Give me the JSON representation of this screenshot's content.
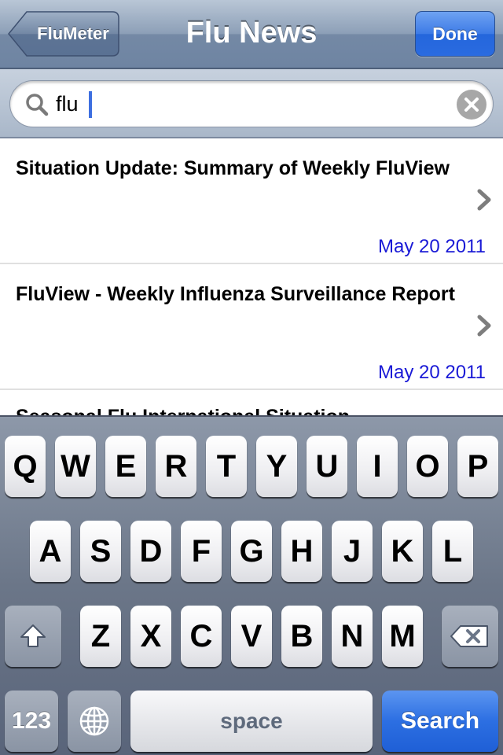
{
  "navbar": {
    "back_label": "FluMeter",
    "title": "Flu News",
    "done_label": "Done"
  },
  "search": {
    "value": "flu"
  },
  "list": {
    "items": [
      {
        "title": "Situation Update: Summary of Weekly FluView",
        "date": "May 20 2011"
      },
      {
        "title": "FluView - Weekly Influenza Surveillance Report",
        "date": "May 20 2011"
      },
      {
        "title": "Seasonal Flu International Situation"
      }
    ]
  },
  "keyboard": {
    "row1": [
      "Q",
      "W",
      "E",
      "R",
      "T",
      "Y",
      "U",
      "I",
      "O",
      "P"
    ],
    "row2": [
      "A",
      "S",
      "D",
      "F",
      "G",
      "H",
      "J",
      "K",
      "L"
    ],
    "row3": [
      "Z",
      "X",
      "C",
      "V",
      "B",
      "N",
      "M"
    ],
    "numbers_label": "123",
    "space_label": "space",
    "search_label": "Search",
    "icons": {
      "shift": "shift-arrow-icon",
      "delete": "backspace-icon",
      "globe": "globe-icon"
    }
  },
  "colors": {
    "link_date": "#1a1ad6",
    "accent_blue": "#2466dc"
  }
}
